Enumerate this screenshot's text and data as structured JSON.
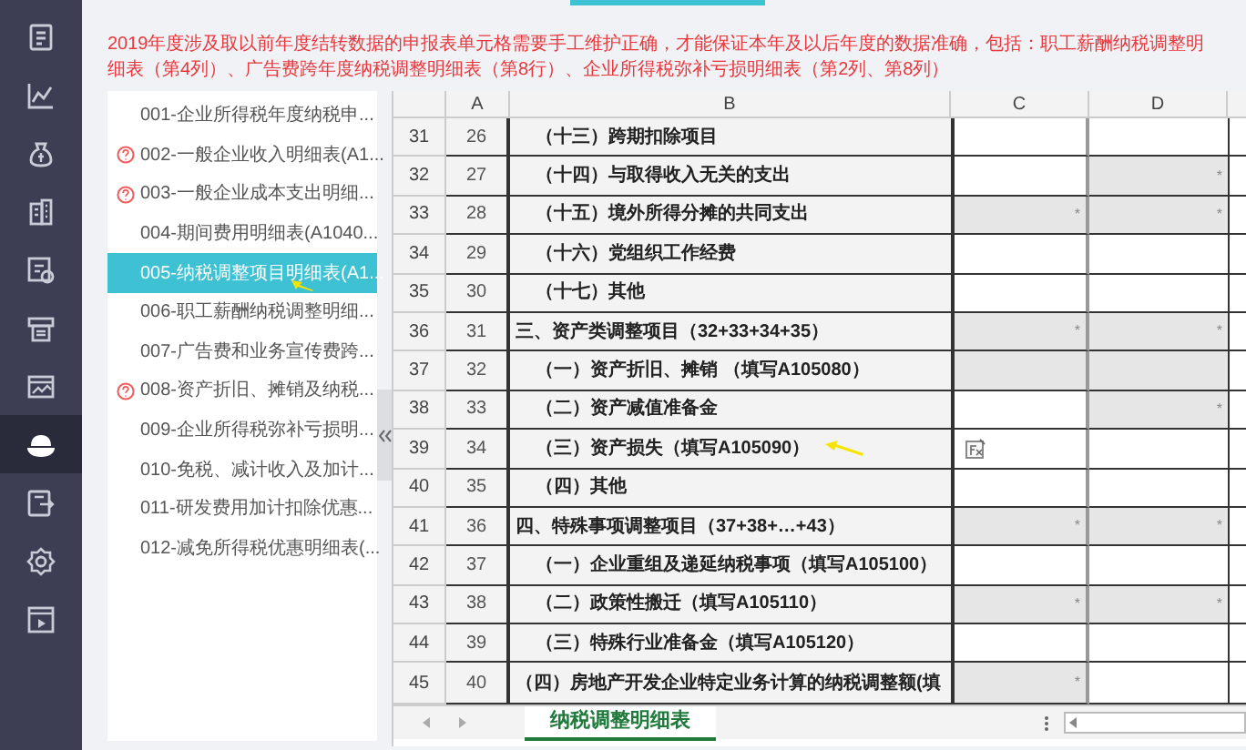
{
  "sidebar": {
    "icons": [
      {
        "kind": "doc",
        "selected": false
      },
      {
        "kind": "chart",
        "selected": false
      },
      {
        "kind": "bag",
        "selected": false
      },
      {
        "kind": "building",
        "selected": false
      },
      {
        "kind": "badge",
        "selected": false
      },
      {
        "kind": "printer",
        "selected": false
      },
      {
        "kind": "image",
        "selected": false
      },
      {
        "kind": "hat",
        "selected": true
      },
      {
        "kind": "export",
        "selected": false
      },
      {
        "kind": "gear",
        "selected": false
      },
      {
        "kind": "play",
        "selected": false
      }
    ]
  },
  "notice": "2019年度涉及取以前年度结转数据的申报表单元格需要手工维护正确，才能保证本年及以后年度的数据准确，包括：职工薪酬纳税调整明细表（第4列）、广告费跨年度纳税调整明细表（第8行）、企业所得税弥补亏损明细表（第2列、第8列）",
  "forms": [
    {
      "label": "001-企业所得税年度纳税申...",
      "warning": false,
      "selected": false
    },
    {
      "label": "002-一般企业收入明细表(A1...",
      "warning": true,
      "selected": false
    },
    {
      "label": "003-一般企业成本支出明细...",
      "warning": true,
      "selected": false
    },
    {
      "label": "004-期间费用明细表(A1040...",
      "warning": false,
      "selected": false
    },
    {
      "label": "005-纳税调整项目明细表(A1...",
      "warning": false,
      "selected": true
    },
    {
      "label": "006-职工薪酬纳税调整明细...",
      "warning": false,
      "selected": false
    },
    {
      "label": "007-广告费和业务宣传费跨...",
      "warning": false,
      "selected": false
    },
    {
      "label": "008-资产折旧、摊销及纳税...",
      "warning": true,
      "selected": false
    },
    {
      "label": "009-企业所得税弥补亏损明...",
      "warning": false,
      "selected": false
    },
    {
      "label": "010-免税、减计收入及加计...",
      "warning": false,
      "selected": false
    },
    {
      "label": "011-研发费用加计扣除优惠...",
      "warning": false,
      "selected": false
    },
    {
      "label": "012-减免所得税优惠明细表(...",
      "warning": false,
      "selected": false
    }
  ],
  "sheet": {
    "columns": [
      "A",
      "B",
      "C",
      "D"
    ],
    "rows": [
      {
        "row": "31",
        "a": "26",
        "b": "（十三）跨期扣除项目",
        "indented": true,
        "c": {
          "locked": false
        },
        "d": {
          "locked": false
        }
      },
      {
        "row": "32",
        "a": "27",
        "b": "（十四）与取得收入无关的支出",
        "indented": true,
        "c": {
          "locked": false
        },
        "d": {
          "locked": true,
          "text": "*"
        }
      },
      {
        "row": "33",
        "a": "28",
        "b": "（十五）境外所得分摊的共同支出",
        "indented": true,
        "c": {
          "locked": true,
          "text": "*"
        },
        "d": {
          "locked": true,
          "text": "*"
        }
      },
      {
        "row": "34",
        "a": "29",
        "b": "（十六）党组织工作经费",
        "indented": true,
        "c": {
          "locked": false
        },
        "d": {
          "locked": false
        }
      },
      {
        "row": "35",
        "a": "30",
        "b": "（十七）其他",
        "indented": true,
        "c": {
          "locked": false
        },
        "d": {
          "locked": false
        }
      },
      {
        "row": "36",
        "a": "31",
        "b": "三、资产类调整项目（32+33+34+35）",
        "indented": false,
        "c": {
          "locked": true,
          "text": "*"
        },
        "d": {
          "locked": true,
          "text": "*"
        }
      },
      {
        "row": "37",
        "a": "32",
        "b": "（一）资产折旧、摊销 （填写A105080）",
        "indented": true,
        "c": {
          "locked": true
        },
        "d": {
          "locked": true
        }
      },
      {
        "row": "38",
        "a": "33",
        "b": "（二）资产减值准备金",
        "indented": true,
        "c": {
          "locked": false
        },
        "d": {
          "locked": true,
          "text": "*"
        }
      },
      {
        "row": "39",
        "a": "34",
        "b": "（三）资产损失（填写A105090）",
        "indented": true,
        "pointer": true,
        "c": {
          "locked": false,
          "formula": true
        },
        "d": {
          "locked": false
        }
      },
      {
        "row": "40",
        "a": "35",
        "b": "（四）其他",
        "indented": true,
        "c": {
          "locked": false
        },
        "d": {
          "locked": false
        }
      },
      {
        "row": "41",
        "a": "36",
        "b": "四、特殊事项调整项目（37+38+…+43）",
        "indented": false,
        "c": {
          "locked": true,
          "text": "*"
        },
        "d": {
          "locked": true,
          "text": "*"
        }
      },
      {
        "row": "42",
        "a": "37",
        "b": "（一）企业重组及递延纳税事项（填写A105100）",
        "indented": true,
        "c": {
          "locked": false
        },
        "d": {
          "locked": false
        }
      },
      {
        "row": "43",
        "a": "38",
        "b": "（二）政策性搬迁（填写A105110）",
        "indented": true,
        "c": {
          "locked": true,
          "text": "*"
        },
        "d": {
          "locked": true,
          "text": "*"
        }
      },
      {
        "row": "44",
        "a": "39",
        "b": "（三）特殊行业准备金（填写A105120）",
        "indented": true,
        "c": {
          "locked": false
        },
        "d": {
          "locked": false
        }
      },
      {
        "row": "45",
        "a": "40",
        "b": "（四）房地产开发企业特定业务计算的纳税调整额(填",
        "indented": false,
        "c": {
          "locked": true,
          "text": "*"
        },
        "d": {
          "locked": false
        }
      }
    ],
    "tabs": [
      {
        "label": "纳税调整明细表",
        "selected": true
      }
    ]
  }
}
